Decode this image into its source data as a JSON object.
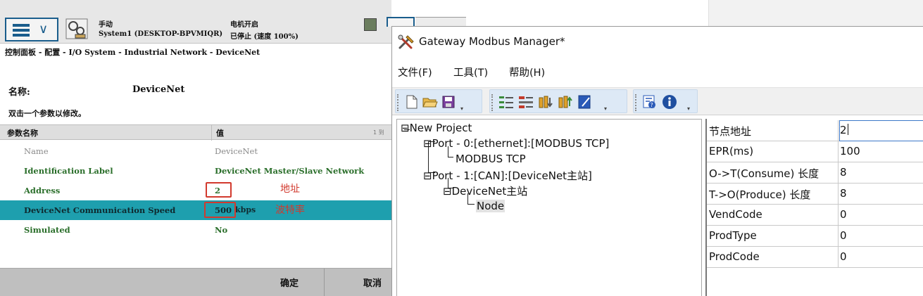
{
  "pendant": {
    "topbar": {
      "mode": "手动",
      "system": "System1 (DESKTOP-BPVMIQR)",
      "motor": "电机开启",
      "state": "已停止 (速度 100%)"
    },
    "breadcrumb": "控制面板 - 配置 - I/O System - Industrial Network - DeviceNet",
    "name_label": "名称:",
    "name_value": "DeviceNet",
    "hint": "双击一个参数以修改。",
    "table": {
      "col_name": "参数名称",
      "col_value": "值",
      "page": "1 到",
      "rows": [
        {
          "name": "Name",
          "value": "DeviceNet"
        },
        {
          "name": "Identification Label",
          "value": "DeviceNet Master/Slave Network"
        },
        {
          "name": "Address",
          "value": "2"
        },
        {
          "name": "DeviceNet Communication Speed",
          "value": "500",
          "unit": "kbps"
        },
        {
          "name": "Simulated",
          "value": "No"
        }
      ]
    },
    "annotations": {
      "address": "地址",
      "baud": "波特率"
    },
    "buttons": {
      "ok": "确定",
      "cancel": "取消"
    }
  },
  "gmm": {
    "title": "Gateway Modbus Manager*",
    "menu": [
      "文件(F)",
      "工具(T)",
      "帮助(H)"
    ],
    "toolbar_icons": [
      "new-file-icon",
      "open-folder-icon",
      "save-icon",
      "add-port-icon",
      "add-device-icon",
      "import-icon",
      "export-icon",
      "edit-icon",
      "config-icon",
      "info-icon"
    ],
    "tree": {
      "root": "New Project",
      "port0": "Port - 0:[ethernet]:[MODBUS TCP]",
      "port0_child": "MODBUS TCP",
      "port1": "Port - 1:[CAN]:[DeviceNet主站]",
      "port1_child": "DeviceNet主站",
      "node": "Node"
    },
    "props": [
      {
        "key": "节点地址",
        "value": "2"
      },
      {
        "key": "EPR(ms)",
        "value": "100"
      },
      {
        "key": "O->T(Consume) 长度",
        "value": "8"
      },
      {
        "key": "T->O(Produce) 长度",
        "value": "8"
      },
      {
        "key": "VendCode",
        "value": "0"
      },
      {
        "key": "ProdType",
        "value": "0"
      },
      {
        "key": "ProdCode",
        "value": "0"
      }
    ]
  },
  "colors": {
    "selection_teal": "#1e9fae",
    "annotation_red": "#d23a2e",
    "param_green": "#2a6e2a",
    "toolbar_blue": "#dde9f6"
  }
}
